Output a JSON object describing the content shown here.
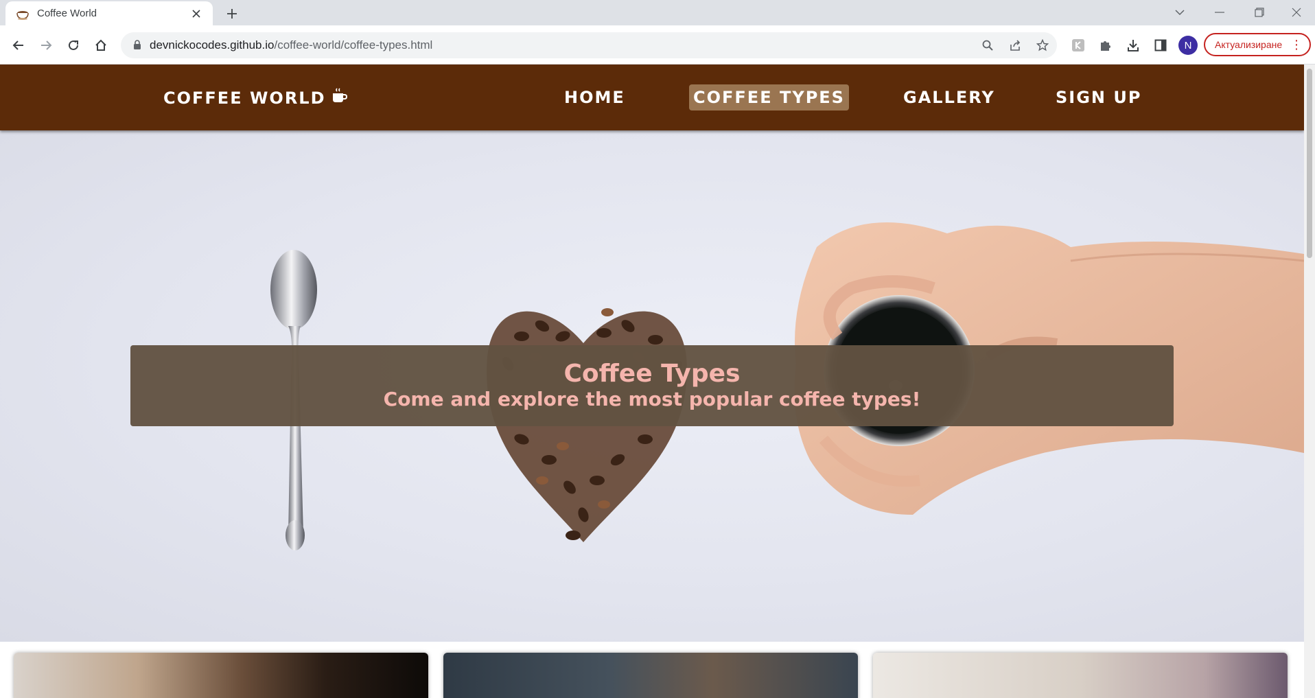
{
  "browser": {
    "tab_title": "Coffee World",
    "favicon": "coffee-cup-icon",
    "url_host": "devnickocodes.github.io",
    "url_path": "/coffee-world/coffee-types.html",
    "profile_initial": "N",
    "update_label": "Актуализиране",
    "update_color": "#c5221f"
  },
  "navbar": {
    "brand": "COFFEE WORLD",
    "brand_icon": "coffee-mug-icon",
    "links": [
      {
        "label": "HOME",
        "active": false
      },
      {
        "label": "COFFEE TYPES",
        "active": true
      },
      {
        "label": "GALLERY",
        "active": false
      },
      {
        "label": "SIGN UP",
        "active": false
      }
    ],
    "bg_color": "#5c2b09",
    "active_color": "#9a7551"
  },
  "hero": {
    "title": "Coffee Types",
    "subtitle": "Come and explore the most popular coffee types!",
    "text_color": "#f5b5ad"
  }
}
